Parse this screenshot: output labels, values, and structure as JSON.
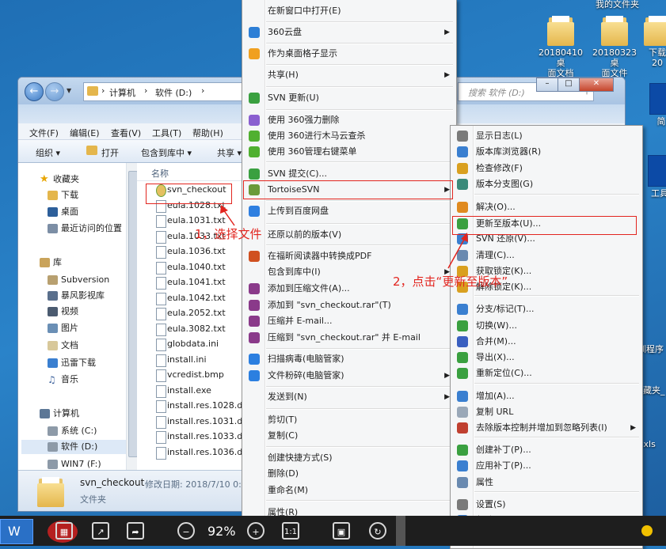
{
  "desktop": {
    "top_right_label": "我的文件夹",
    "icons": [
      {
        "label": "20180410桌面文档",
        "line1": "20180410桌",
        "line2": "面文档"
      },
      {
        "label": "20180323桌面文件",
        "line1": "20180323桌",
        "line2": "面文件"
      },
      {
        "label": "下载20",
        "line1": "下载",
        "line2": "20"
      },
      {
        "label": "简",
        "line1": "简",
        "line2": ""
      },
      {
        "label": "工具",
        "line1": "工具",
        "line2": ""
      }
    ],
    "side_texts": [
      "圳程序",
      "收藏夹_",
      ".xls"
    ]
  },
  "explorer": {
    "breadcrumb": [
      "计算机",
      "软件 (D:)"
    ],
    "search_placeholder": "搜索 软件 (D:)",
    "menubar": [
      "文件(F)",
      "编辑(E)",
      "查看(V)",
      "工具(T)",
      "帮助(H)"
    ],
    "toolbar": [
      "组织 ▾",
      "打开",
      "包含到库中 ▾",
      "共享 ▾"
    ],
    "nav": {
      "favorites": "收藏夹",
      "favorite_items": [
        "下载",
        "桌面",
        "最近访问的位置"
      ],
      "libraries": "库",
      "library_items": [
        "Subversion",
        "暴风影视库",
        "视频",
        "图片",
        "文档",
        "迅雷下载",
        "音乐"
      ],
      "computer": "计算机",
      "computer_items": [
        "系统 (C:)",
        "软件 (D:)",
        "WIN7 (F:)"
      ]
    },
    "column_name": "名称",
    "files": [
      "svn_checkout",
      "eula.1028.txt",
      "eula.1031.txt",
      "eula.1033.txt",
      "eula.1036.txt",
      "eula.1040.txt",
      "eula.1041.txt",
      "eula.1042.txt",
      "eula.2052.txt",
      "eula.3082.txt",
      "globdata.ini",
      "install.ini",
      "vcredist.bmp",
      "install.exe",
      "install.res.1028.dll",
      "install.res.1031.dll",
      "install.res.1033.dll",
      "install.res.1036.dll"
    ],
    "details": {
      "name": "svn_checkout",
      "modified_label": "修改日期: 2018/7/10 0:",
      "type": "文件夹"
    }
  },
  "context_menu": {
    "items": [
      {
        "label": "在新窗口中打开(E)",
        "icon": "none-icon"
      },
      {
        "label": "360云盘",
        "icon": "cloud-icon",
        "submenu": true
      },
      {
        "label": "作为桌面格子显示",
        "icon": "grid-icon"
      },
      {
        "label": "共享(H)",
        "icon": "none-icon",
        "submenu": true
      },
      {
        "label": "SVN 更新(U)",
        "icon": "svn-update-icon"
      },
      {
        "label": "使用 360强力删除",
        "icon": "purple-ball-icon"
      },
      {
        "label": "使用 360进行木马云查杀",
        "icon": "shield-360-icon"
      },
      {
        "label": "使用 360管理右键菜单",
        "icon": "shield-360-icon"
      },
      {
        "label": "SVN 提交(C)...",
        "icon": "svn-commit-icon"
      },
      {
        "label": "TortoiseSVN",
        "icon": "tortoise-icon",
        "submenu": true
      },
      {
        "label": "上传到百度网盘",
        "icon": "baidu-cloud-icon"
      },
      {
        "label": "还原以前的版本(V)",
        "icon": "none-icon"
      },
      {
        "label": "在福昕阅读器中转换成PDF",
        "icon": "pdf-icon"
      },
      {
        "label": "包含到库中(I)",
        "icon": "none-icon",
        "submenu": true
      },
      {
        "label": "添加到压缩文件(A)...",
        "icon": "winrar-icon"
      },
      {
        "label": "添加到 \"svn_checkout.rar\"(T)",
        "icon": "winrar-icon"
      },
      {
        "label": "压缩并 E-mail...",
        "icon": "winrar-icon"
      },
      {
        "label": "压缩到 \"svn_checkout.rar\" 并 E-mail",
        "icon": "winrar-icon"
      },
      {
        "label": "扫描病毒(电脑管家)",
        "icon": "qq-shield-icon"
      },
      {
        "label": "文件粉碎(电脑管家)",
        "icon": "qq-shield-icon",
        "submenu": true
      },
      {
        "label": "发送到(N)",
        "icon": "none-icon",
        "submenu": true
      },
      {
        "label": "剪切(T)",
        "icon": "none-icon"
      },
      {
        "label": "复制(C)",
        "icon": "none-icon"
      },
      {
        "label": "创建快捷方式(S)",
        "icon": "none-icon"
      },
      {
        "label": "删除(D)",
        "icon": "none-icon"
      },
      {
        "label": "重命名(M)",
        "icon": "none-icon"
      },
      {
        "label": "属性(R)",
        "icon": "none-icon"
      }
    ]
  },
  "svn_submenu": {
    "items": [
      {
        "label": "显示日志(L)",
        "icon": "log-icon"
      },
      {
        "label": "版本库浏览器(R)",
        "icon": "repo-browser-icon"
      },
      {
        "label": "检查修改(F)",
        "icon": "check-mod-icon"
      },
      {
        "label": "版本分支图(G)",
        "icon": "revision-graph-icon"
      },
      {
        "label": "解决(O)...",
        "icon": "resolve-icon"
      },
      {
        "label": "更新至版本(U)...",
        "icon": "update-to-revision-icon"
      },
      {
        "label": "SVN 还原(V)...",
        "icon": "revert-icon"
      },
      {
        "label": "清理(C)...",
        "icon": "cleanup-icon"
      },
      {
        "label": "获取锁定(K)...",
        "icon": "lock-icon"
      },
      {
        "label": "解除锁定(K)...",
        "icon": "unlock-icon"
      },
      {
        "label": "分支/标记(T)...",
        "icon": "branch-icon"
      },
      {
        "label": "切换(W)...",
        "icon": "switch-icon"
      },
      {
        "label": "合并(M)...",
        "icon": "merge-icon"
      },
      {
        "label": "导出(X)...",
        "icon": "export-icon"
      },
      {
        "label": "重新定位(C)...",
        "icon": "relocate-icon"
      },
      {
        "label": "增加(A)...",
        "icon": "add-icon"
      },
      {
        "label": "复制 URL",
        "icon": "copy-url-icon"
      },
      {
        "label": "去除版本控制并增加到忽略列表(I)",
        "icon": "ignore-icon",
        "submenu": true
      },
      {
        "label": "创建补丁(P)...",
        "icon": "create-patch-icon"
      },
      {
        "label": "应用补丁(P)...",
        "icon": "apply-patch-icon"
      },
      {
        "label": "属性",
        "icon": "properties-icon"
      },
      {
        "label": "设置(S)",
        "icon": "settings-icon"
      },
      {
        "label": "帮助(H)",
        "icon": "help-icon"
      },
      {
        "label": "关于",
        "icon": "about-icon"
      }
    ]
  },
  "annotations": {
    "step1": "1，选择文件",
    "step2": "2，点击“更新至版本”"
  },
  "viewer": {
    "zoom": "92%",
    "one_to_one": "1:1"
  },
  "colors": {
    "annotation_red": "#e2251f",
    "desktop_blue": "#2a83c9"
  }
}
